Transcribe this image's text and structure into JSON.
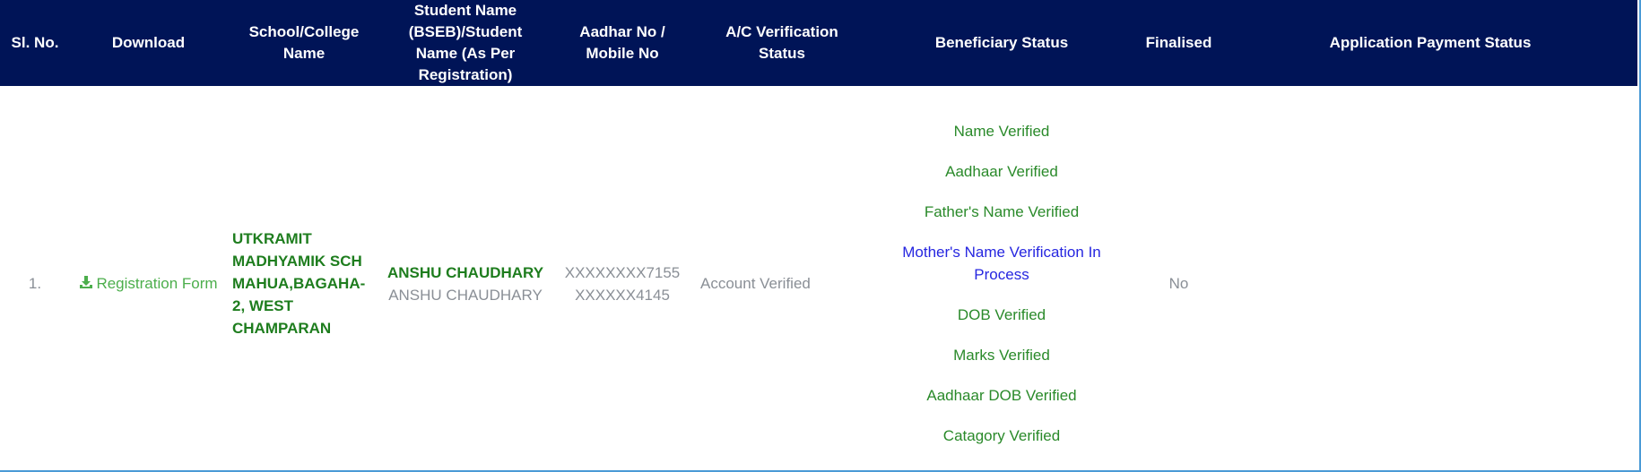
{
  "table": {
    "headers": {
      "sl_no": "Sl. No.",
      "download": "Download",
      "school": "School/College Name",
      "student_name": "Student Name (BSEB)/Student Name (As Per Registration)",
      "aadhar": "Aadhar No / Mobile No",
      "ac_status": "A/C Verification Status",
      "beneficiary": "Beneficiary Status",
      "finalised": "Finalised",
      "payment": "Application Payment Status"
    },
    "row": {
      "sl_no": "1.",
      "download_label": "Registration Form",
      "download_icon": "download-icon",
      "school_name": "UTKRAMIT MADHYAMIK SCH MAHUA,BAGAHA-2, WEST CHAMPARAN",
      "student_name_bseb": "ANSHU CHAUDHARY",
      "student_name_reg": "ANSHU CHAUDHARY",
      "aadhar_no": "XXXXXXXX7155",
      "mobile_no": "XXXXXX4145",
      "ac_status": "Account Verified",
      "beneficiary_status": [
        "Name Verified",
        "Aadhaar Verified",
        "Father's Name Verified",
        "Mother's Name Verification In Process",
        "DOB Verified",
        "Marks Verified",
        "Aadhaar DOB Verified",
        "Catagory Verified"
      ],
      "finalised": "No",
      "payment_status": ""
    }
  },
  "colors": {
    "header_bg": "#001457",
    "header_text": "#ffffff",
    "verified_green": "#2a8a2a",
    "in_process_blue": "#2626e0",
    "muted_gray": "#8a8f96",
    "link_green": "#4cae4c"
  }
}
